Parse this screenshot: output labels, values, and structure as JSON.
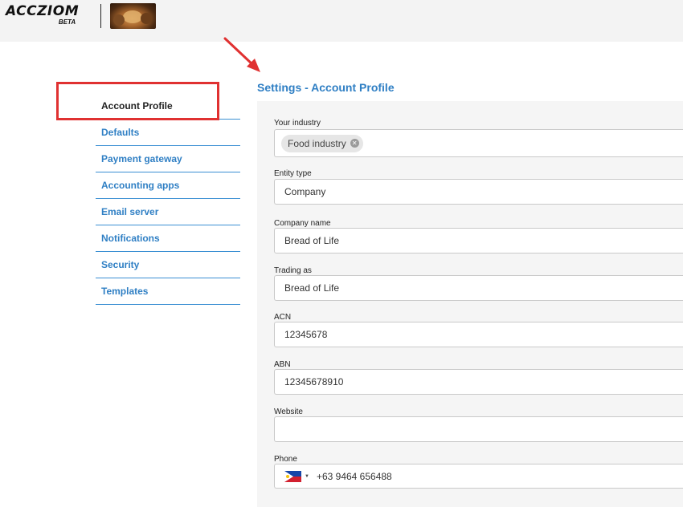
{
  "header": {
    "logo_text": "ACCZIOM",
    "logo_badge": "BETA"
  },
  "sidebar": {
    "items": [
      {
        "label": "Account Profile",
        "active": true
      },
      {
        "label": "Defaults"
      },
      {
        "label": "Payment gateway"
      },
      {
        "label": "Accounting apps"
      },
      {
        "label": "Email server"
      },
      {
        "label": "Notifications"
      },
      {
        "label": "Security"
      },
      {
        "label": "Templates"
      }
    ]
  },
  "page": {
    "title": "Settings - Account Profile"
  },
  "form": {
    "industry": {
      "label": "Your industry",
      "chip": "Food industry"
    },
    "entity_type": {
      "label": "Entity type",
      "value": "Company"
    },
    "company_name": {
      "label": "Company name",
      "value": "Bread of Life"
    },
    "trading_as": {
      "label": "Trading as",
      "value": "Bread of Life"
    },
    "acn": {
      "label": "ACN",
      "value": "12345678"
    },
    "abn": {
      "label": "ABN",
      "value": "12345678910"
    },
    "website": {
      "label": "Website",
      "value": ""
    },
    "phone": {
      "label": "Phone",
      "value": "+63 9464 656488",
      "country": "Philippines"
    }
  },
  "colors": {
    "accent": "#2f7fc4",
    "highlight": "#e03131",
    "panel_bg": "#f5f5f5"
  }
}
